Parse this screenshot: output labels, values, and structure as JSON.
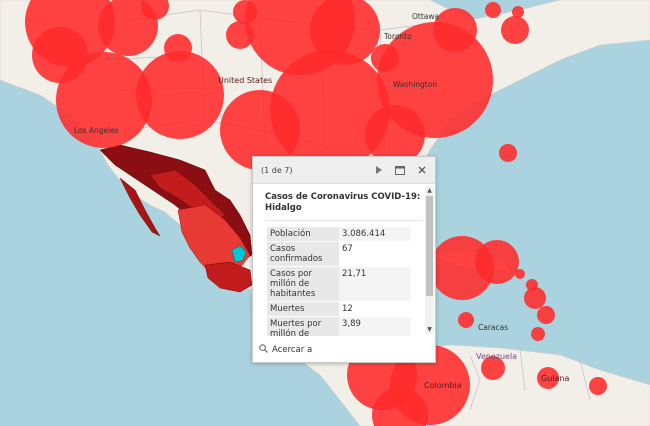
{
  "map": {
    "labels": {
      "ottawa": "Ottawa",
      "toronto": "Toronto",
      "united_states": "United States",
      "washington": "Washington",
      "los_angeles": "Los Angeles",
      "caracas": "Caracas",
      "venezuela": "Venezuela",
      "colombia": "Colombia",
      "guiana": "Guiana"
    },
    "colors": {
      "water": "#aad3df",
      "land": "#f2efe9",
      "bubble": "#ff2a2a",
      "mexico_dark": "#8b0e12",
      "mexico_mid": "#c21c1c",
      "mexico_light": "#e83a34",
      "highlight": "#00c8d2"
    }
  },
  "popup": {
    "pager": "(1 de 7)",
    "title": "Casos de Coronavirus COVID-19: Hidalgo",
    "rows": [
      {
        "key": "Población",
        "value": "3.086.414"
      },
      {
        "key": "Casos confirmados",
        "value": "67"
      },
      {
        "key": "Casos por millón de habitantes",
        "value": "21,71"
      },
      {
        "key": "Muertes",
        "value": "12"
      },
      {
        "key": "Muertes por millón de",
        "value": "3,89"
      }
    ],
    "zoom_label": "Acercar a",
    "icons": {
      "next": "play-icon",
      "dock": "dock-icon",
      "close": "close-icon",
      "zoom": "magnifier-icon"
    }
  }
}
